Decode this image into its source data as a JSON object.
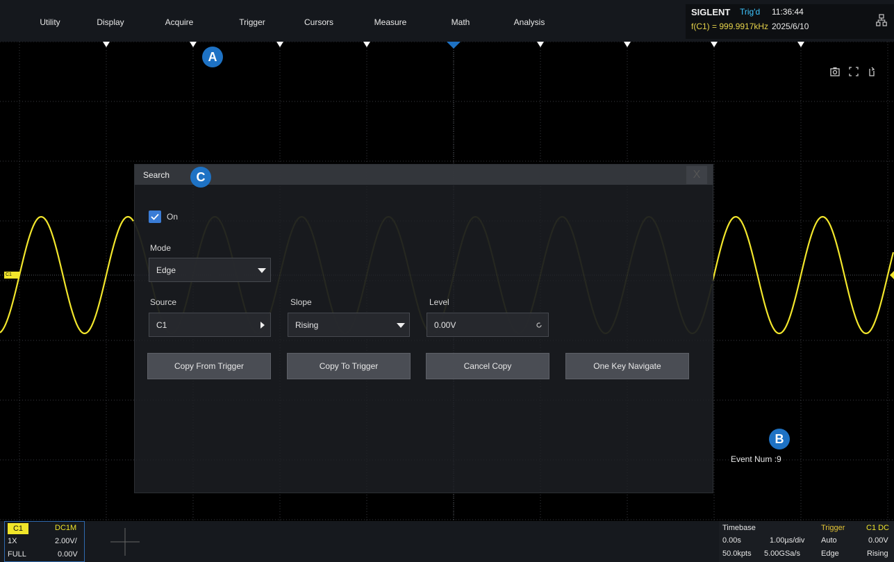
{
  "menu": {
    "items": [
      "Utility",
      "Display",
      "Acquire",
      "Trigger",
      "Cursors",
      "Measure",
      "Math",
      "Analysis"
    ]
  },
  "status": {
    "brand": "SIGLENT",
    "trigger_state": "Trig'd",
    "frequency": "f(C1) = 999.9917kHz",
    "time": "11:36:44",
    "date": "2025/6/10",
    "icons": [
      "network-icon"
    ]
  },
  "colors": {
    "trace": "#f2e62c",
    "accent": "#1e72c4",
    "checkbox": "#3a7cd6",
    "trigger_label": "#e6c635"
  },
  "markers": {
    "a": "A",
    "b": "B",
    "c": "C"
  },
  "toolbar_icons": [
    "camera-icon",
    "fullscreen-icon",
    "rotate-icon"
  ],
  "event_num": "Event Num :9",
  "search": {
    "title": "Search",
    "close": "X",
    "on_label": "On",
    "on_checked": true,
    "mode_label": "Mode",
    "mode_value": "Edge",
    "source_label": "Source",
    "source_value": "C1",
    "slope_label": "Slope",
    "slope_value": "Rising",
    "level_label": "Level",
    "level_value": "0.00V",
    "buttons": [
      "Copy From Trigger",
      "Copy To Trigger",
      "Cancel Copy",
      "One Key Navigate"
    ]
  },
  "channel": {
    "name": "C1",
    "coupling": "DC1M",
    "probe": "1X",
    "scale": "2.00V/",
    "bandwidth": "FULL",
    "offset": "0.00V",
    "level_tag": "C1"
  },
  "timebase": {
    "title": "Timebase",
    "delay": "0.00s",
    "scale": "1.00µs/div",
    "memory": "50.0kpts",
    "rate": "5.00GSa/s"
  },
  "trigger": {
    "title": "Trigger",
    "source": "C1 DC",
    "mode": "Auto",
    "level": "0.00V",
    "type": "Edge",
    "slope": "Rising"
  }
}
